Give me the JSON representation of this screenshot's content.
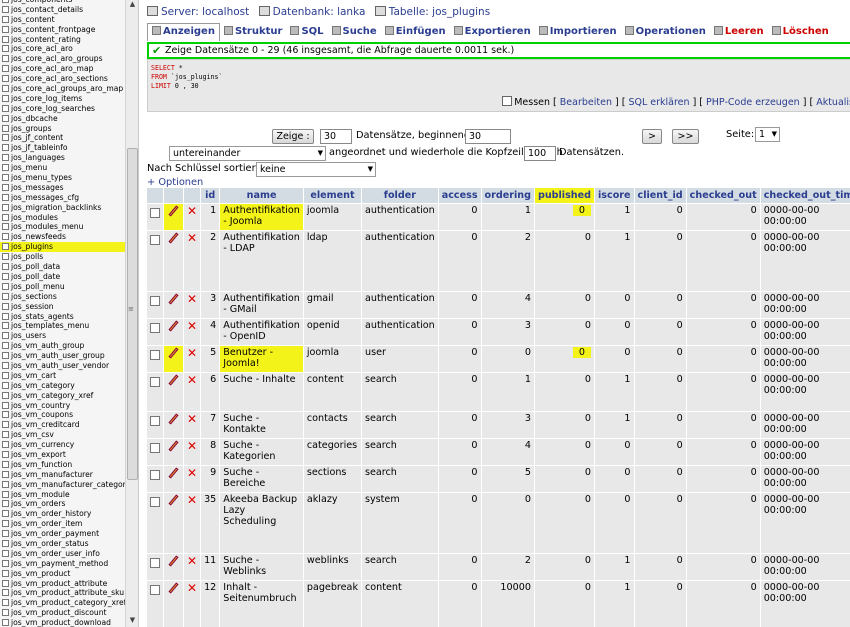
{
  "sidebar": {
    "tables": [
      "jos_components",
      "jos_contact_details",
      "jos_content",
      "jos_content_frontpage",
      "jos_content_rating",
      "jos_core_acl_aro",
      "jos_core_acl_aro_groups",
      "jos_core_acl_aro_map",
      "jos_core_acl_aro_sections",
      "jos_core_acl_groups_aro_map",
      "jos_core_log_items",
      "jos_core_log_searches",
      "jos_dbcache",
      "jos_groups",
      "jos_jf_content",
      "jos_jf_tableinfo",
      "jos_languages",
      "jos_menu",
      "jos_menu_types",
      "jos_messages",
      "jos_messages_cfg",
      "jos_migration_backlinks",
      "jos_modules",
      "jos_modules_menu",
      "jos_newsfeeds",
      "jos_plugins",
      "jos_polls",
      "jos_poll_data",
      "jos_poll_date",
      "jos_poll_menu",
      "jos_sections",
      "jos_session",
      "jos_stats_agents",
      "jos_templates_menu",
      "jos_users",
      "jos_vm_auth_group",
      "jos_vm_auth_user_group",
      "jos_vm_auth_user_vendor",
      "jos_vm_cart",
      "jos_vm_category",
      "jos_vm_category_xref",
      "jos_vm_country",
      "jos_vm_coupons",
      "jos_vm_creditcard",
      "jos_vm_csv",
      "jos_vm_currency",
      "jos_vm_export",
      "jos_vm_function",
      "jos_vm_manufacturer",
      "jos_vm_manufacturer_category",
      "jos_vm_module",
      "jos_vm_orders",
      "jos_vm_order_history",
      "jos_vm_order_item",
      "jos_vm_order_payment",
      "jos_vm_order_status",
      "jos_vm_order_user_info",
      "jos_vm_payment_method",
      "jos_vm_product",
      "jos_vm_product_attribute",
      "jos_vm_product_attribute_sku",
      "jos_vm_product_category_xref",
      "jos_vm_product_discount",
      "jos_vm_product_download"
    ],
    "highlighted_table": "jos_plugins"
  },
  "breadcrumb": {
    "server": "Server: localhost",
    "database": "Datenbank: lanka",
    "table": "Tabelle: jos_plugins"
  },
  "tabs": [
    {
      "label": "Anzeigen",
      "active": true
    },
    {
      "label": "Struktur"
    },
    {
      "label": "SQL"
    },
    {
      "label": "Suche"
    },
    {
      "label": "Einfügen"
    },
    {
      "label": "Exportieren"
    },
    {
      "label": "Importieren"
    },
    {
      "label": "Operationen"
    },
    {
      "label": "Leeren",
      "danger": true
    },
    {
      "label": "Löschen",
      "danger": true
    }
  ],
  "status_message": "Zeige Datensätze 0 - 29 (46 insgesamt, die Abfrage dauerte 0.0011 sek.)",
  "sql": {
    "line1_kw": "SELECT",
    "line1_rest": " *",
    "line2_kw": "FROM",
    "line2_rest": " `jos_plugins`",
    "line3_kw": "LIMIT",
    "line3_rest": " 0 , 30",
    "profiling_label": "Messen",
    "edit_link": "Bearbeiten",
    "explain_link": "SQL erklären",
    "php_link": "PHP-Code erzeugen",
    "refresh_link": "Aktualis"
  },
  "nav": {
    "show_button": "Zeige :",
    "rows_value": "30",
    "rows_label": "Datensätze, beginnend ab",
    "start_value": "30",
    "next_button": ">",
    "last_button": ">>",
    "page_label": "Seite:",
    "page_value": "1",
    "mode_value": "untereinander",
    "repeat_label": "angeordnet und wiederhole die Kopfzeilen nach",
    "repeat_value": "100",
    "repeat_suffix": "Datensätzen.",
    "sort_label": "Nach Schlüssel sortieren:",
    "sort_value": "keine",
    "options_link": "+ Optionen"
  },
  "table": {
    "columns": [
      "id",
      "name",
      "element",
      "folder",
      "access",
      "ordering",
      "published",
      "iscore",
      "client_id",
      "checked_out",
      "checked_out_time"
    ],
    "rows": [
      {
        "id": "1",
        "name": "Authentifikation - Joomla",
        "element": "joomla",
        "folder": "authentication",
        "access": "0",
        "ordering": "1",
        "published": "0",
        "iscore": "1",
        "client_id": "0",
        "checked_out": "0",
        "checked_out_time": "0000-00-00 00:00:00"
      },
      {
        "id": "2",
        "name": "Authentifikation - LDAP",
        "element": "ldap",
        "folder": "authentication",
        "access": "0",
        "ordering": "2",
        "published": "0",
        "iscore": "1",
        "client_id": "0",
        "checked_out": "0",
        "checked_out_time": "0000-00-00 00:00:00"
      },
      {
        "id": "3",
        "name": "Authentifikation - GMail",
        "element": "gmail",
        "folder": "authentication",
        "access": "0",
        "ordering": "4",
        "published": "0",
        "iscore": "0",
        "client_id": "0",
        "checked_out": "0",
        "checked_out_time": "0000-00-00 00:00:00"
      },
      {
        "id": "4",
        "name": "Authentifikation - OpenID",
        "element": "openid",
        "folder": "authentication",
        "access": "0",
        "ordering": "3",
        "published": "0",
        "iscore": "0",
        "client_id": "0",
        "checked_out": "0",
        "checked_out_time": "0000-00-00 00:00:00"
      },
      {
        "id": "5",
        "name": "Benutzer - Joomla!",
        "element": "joomla",
        "folder": "user",
        "access": "0",
        "ordering": "0",
        "published": "0",
        "iscore": "0",
        "client_id": "0",
        "checked_out": "0",
        "checked_out_time": "0000-00-00 00:00:00"
      },
      {
        "id": "6",
        "name": "Suche - Inhalte",
        "element": "content",
        "folder": "search",
        "access": "0",
        "ordering": "1",
        "published": "0",
        "iscore": "1",
        "client_id": "0",
        "checked_out": "0",
        "checked_out_time": "0000-00-00 00:00:00"
      },
      {
        "id": "7",
        "name": "Suche - Kontakte",
        "element": "contacts",
        "folder": "search",
        "access": "0",
        "ordering": "3",
        "published": "0",
        "iscore": "1",
        "client_id": "0",
        "checked_out": "0",
        "checked_out_time": "0000-00-00 00:00:00"
      },
      {
        "id": "8",
        "name": "Suche - Kategorien",
        "element": "categories",
        "folder": "search",
        "access": "0",
        "ordering": "4",
        "published": "0",
        "iscore": "0",
        "client_id": "0",
        "checked_out": "0",
        "checked_out_time": "0000-00-00 00:00:00"
      },
      {
        "id": "9",
        "name": "Suche - Bereiche",
        "element": "sections",
        "folder": "search",
        "access": "0",
        "ordering": "5",
        "published": "0",
        "iscore": "0",
        "client_id": "0",
        "checked_out": "0",
        "checked_out_time": "0000-00-00 00:00:00"
      },
      {
        "id": "35",
        "name": "Akeeba Backup Lazy Scheduling",
        "element": "aklazy",
        "folder": "system",
        "access": "0",
        "ordering": "0",
        "published": "0",
        "iscore": "0",
        "client_id": "0",
        "checked_out": "0",
        "checked_out_time": "0000-00-00 00:00:00"
      },
      {
        "id": "11",
        "name": "Suche - Weblinks",
        "element": "weblinks",
        "folder": "search",
        "access": "0",
        "ordering": "2",
        "published": "0",
        "iscore": "1",
        "client_id": "0",
        "checked_out": "0",
        "checked_out_time": "0000-00-00 00:00:00"
      },
      {
        "id": "12",
        "name": "Inhalt - Seitenumbruch",
        "element": "pagebreak",
        "folder": "content",
        "access": "0",
        "ordering": "10000",
        "published": "0",
        "iscore": "1",
        "client_id": "0",
        "checked_out": "0",
        "checked_out_time": "0000-00-00 00:00:00"
      }
    ]
  },
  "colors": {
    "highlight": "#f3f31a",
    "link": "#2a3d8f",
    "header_bg": "#d3dce3",
    "row_bg": "#e8e8e8",
    "success_border": "#00d000"
  }
}
